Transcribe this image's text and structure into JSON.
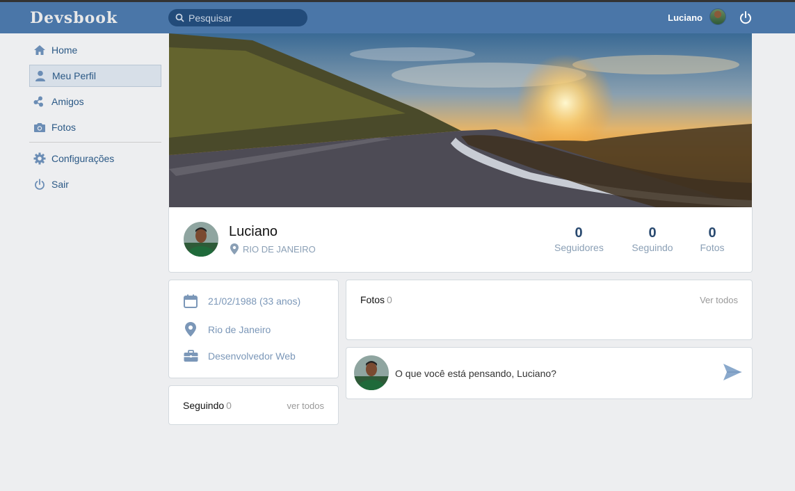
{
  "header": {
    "logo": "Devsbook",
    "search_placeholder": "Pesquisar",
    "user_name": "Luciano"
  },
  "sidebar": {
    "items": [
      {
        "label": "Home",
        "icon": "home-icon"
      },
      {
        "label": "Meu Perfil",
        "icon": "user-icon",
        "active": true
      },
      {
        "label": "Amigos",
        "icon": "friends-icon"
      },
      {
        "label": "Fotos",
        "icon": "camera-icon"
      },
      {
        "label": "Configurações",
        "icon": "gear-icon"
      },
      {
        "label": "Sair",
        "icon": "power-icon"
      }
    ]
  },
  "profile": {
    "name": "Luciano",
    "location": "RIO DE JANEIRO",
    "stats": [
      {
        "value": "0",
        "label": "Seguidores"
      },
      {
        "value": "0",
        "label": "Seguindo"
      },
      {
        "value": "0",
        "label": "Fotos"
      }
    ]
  },
  "info": {
    "birth": "21/02/1988 (33 anos)",
    "city": "Rio de Janeiro",
    "work": "Desenvolvedor Web"
  },
  "following": {
    "title": "Seguindo",
    "count": "0",
    "link": "ver todos"
  },
  "photos": {
    "title": "Fotos",
    "count": "0",
    "link": "Ver todos"
  },
  "post": {
    "placeholder": "O que você está pensando, Luciano?"
  },
  "colors": {
    "header": "#4a76a8",
    "link": "#2a5885",
    "muted": "#8a9fb5",
    "background": "#edeef0"
  }
}
